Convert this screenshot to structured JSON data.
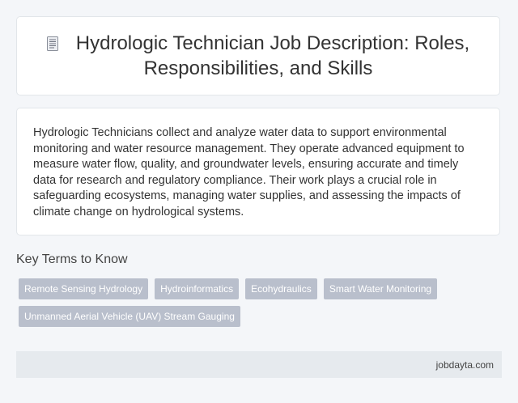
{
  "header": {
    "icon": "document-icon",
    "title": "Hydrologic Technician Job Description: Roles, Responsibilities, and Skills"
  },
  "description": {
    "text": "Hydrologic Technicians collect and analyze water data to support environmental monitoring and water resource management. They operate advanced equipment to measure water flow, quality, and groundwater levels, ensuring accurate and timely data for research and regulatory compliance. Their work plays a crucial role in safeguarding ecosystems, managing water supplies, and assessing the impacts of climate change on hydrological systems."
  },
  "key_terms": {
    "heading": "Key Terms to Know",
    "tags": [
      "Remote Sensing Hydrology",
      "Hydroinformatics",
      "Ecohydraulics",
      "Smart Water Monitoring",
      "Unmanned Aerial Vehicle (UAV) Stream Gauging"
    ]
  },
  "footer": {
    "site": "jobdayta.com"
  }
}
